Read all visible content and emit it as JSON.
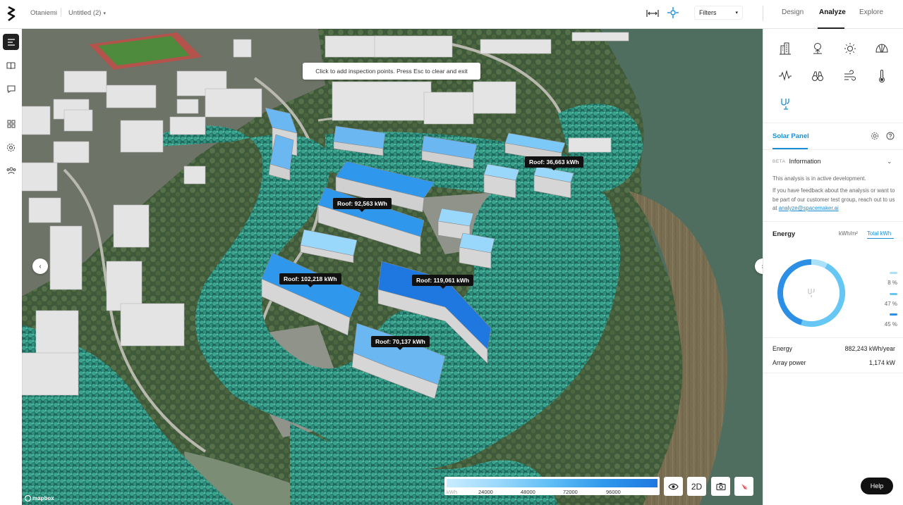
{
  "header": {
    "project": "Otaniemi",
    "file": "Untitled (2)",
    "filters_label": "Filters",
    "tabs": [
      "Design",
      "Analyze",
      "Explore"
    ],
    "active_tab": "Analyze"
  },
  "map": {
    "toast": "Click to add inspection points. Press Esc to clear and exit",
    "roof_labels": [
      "Roof: 36,663 kWh",
      "Roof: 92,563 kWh",
      "Roof: 102,218 kWh",
      "Roof: 119,061 kWh",
      "Roof: 70,137 kWh"
    ],
    "legend": {
      "unit": "kWh",
      "ticks": [
        "24000",
        "48000",
        "72000",
        "96000"
      ]
    },
    "view_toggle": "2D",
    "attribution": "mapbox"
  },
  "panel": {
    "section_title": "Solar Panel",
    "info": {
      "badge": "BETA",
      "title": "Information",
      "text1": "This analysis is in active development.",
      "text2": "If you have feedback about the analysis or want to be part of our customer test group, reach out to us at",
      "email": "analyze@spacemaker.ai"
    },
    "energy": {
      "title": "Energy",
      "unit_tabs": [
        "kWh/m²",
        "Total kWh"
      ],
      "active_unit": "Total kWh",
      "breakdown": [
        {
          "pct": "8 %",
          "value": 8,
          "color": "#a9e1fb"
        },
        {
          "pct": "47 %",
          "value": 47,
          "color": "#66c7f5"
        },
        {
          "pct": "45 %",
          "value": 45,
          "color": "#2b8fe6"
        }
      ]
    },
    "stats": [
      {
        "label": "Energy",
        "value": "882,243 kWh/year"
      },
      {
        "label": "Array power",
        "value": "1,174 kW"
      }
    ]
  },
  "help_label": "Help"
}
